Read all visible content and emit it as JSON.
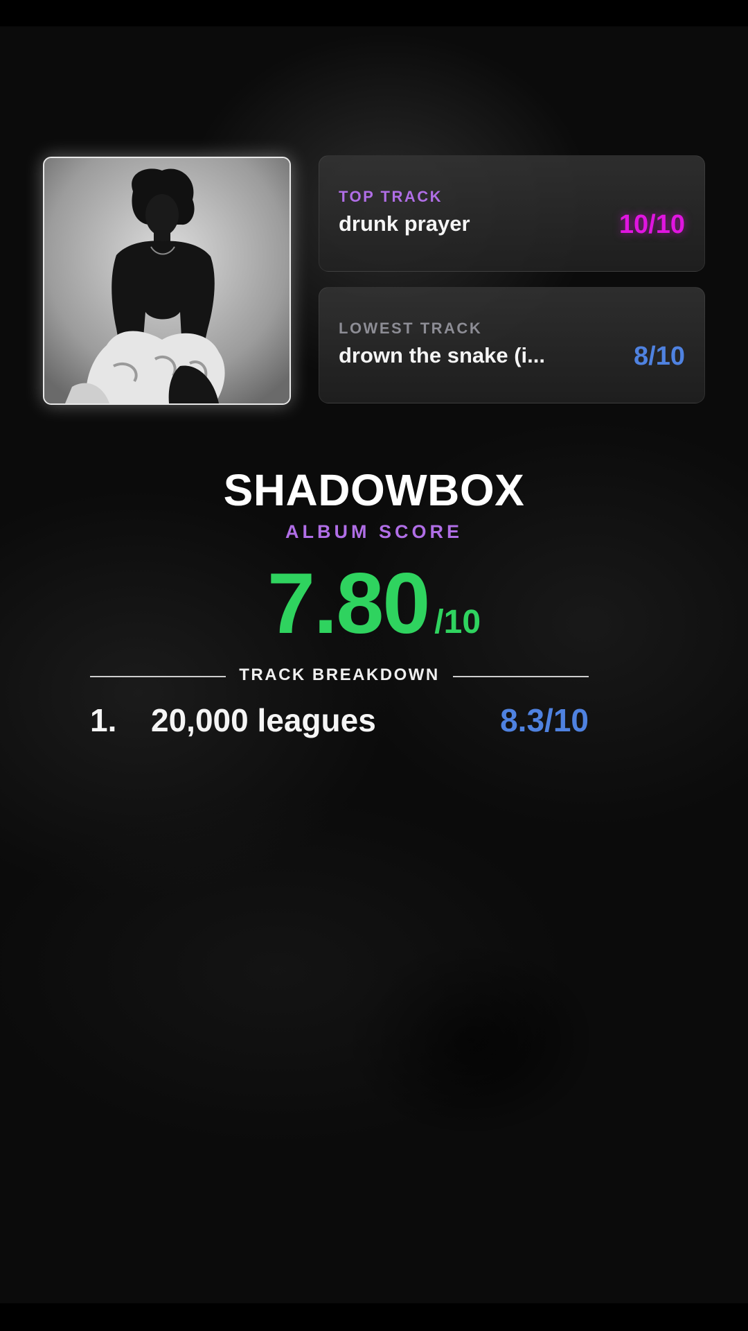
{
  "album": {
    "title": "SHADOWBOX",
    "score_label": "ALBUM SCORE",
    "score_value": "7.80",
    "score_max": "/10"
  },
  "top_track": {
    "label": "TOP TRACK",
    "name": "drunk prayer",
    "score": "10/10"
  },
  "lowest_track": {
    "label": "LOWEST TRACK",
    "name": "drown the snake (i...",
    "score": "8/10"
  },
  "breakdown": {
    "label": "TRACK BREAKDOWN",
    "tracks": [
      {
        "number": "1.",
        "name": "20,000 leagues",
        "score": "8.3/10"
      }
    ]
  },
  "colors": {
    "accent_purple": "#b06ee6",
    "top_score_magenta": "#e015e0",
    "score_blue": "#4f82e0",
    "album_score_green": "#2fd35f"
  }
}
